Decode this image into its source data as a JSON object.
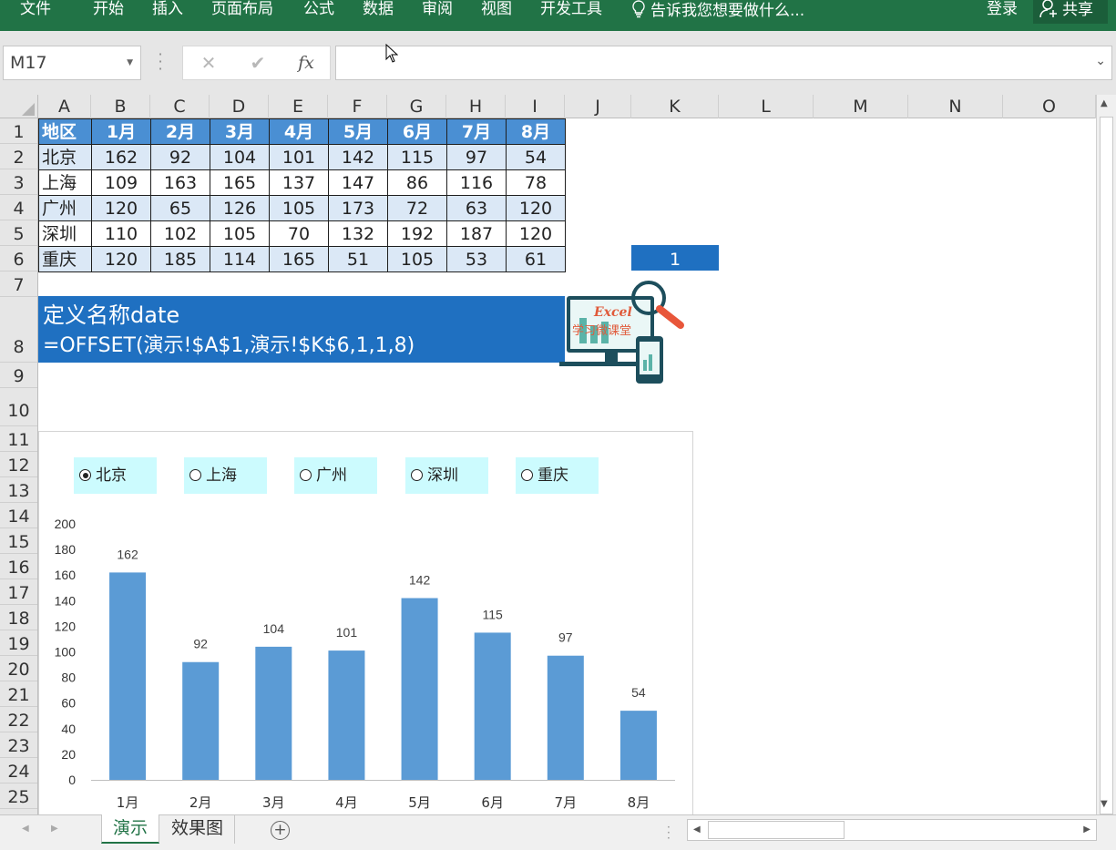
{
  "ribbon": {
    "tabs": [
      "文件",
      "开始",
      "插入",
      "页面布局",
      "公式",
      "数据",
      "审阅",
      "视图",
      "开发工具"
    ],
    "tell_me": "告诉我您想要做什么...",
    "login": "登录",
    "share": "共享"
  },
  "formula_bar": {
    "name_box": "M17",
    "cancel_icon": "✕",
    "enter_icon": "✔",
    "fx_label": "fx",
    "formula": ""
  },
  "columns": [
    "A",
    "B",
    "C",
    "D",
    "E",
    "F",
    "G",
    "H",
    "I",
    "J",
    "K",
    "L",
    "M",
    "N",
    "O"
  ],
  "rows": [
    "1",
    "2",
    "3",
    "4",
    "5",
    "6",
    "7",
    "8",
    "9",
    "10",
    "11",
    "12",
    "13",
    "14",
    "15",
    "16",
    "17",
    "18",
    "19",
    "20",
    "21",
    "22",
    "23",
    "24",
    "25"
  ],
  "table": {
    "header": [
      "地区",
      "1月",
      "2月",
      "3月",
      "4月",
      "5月",
      "6月",
      "7月",
      "8月"
    ],
    "rows": [
      [
        "北京",
        "162",
        "92",
        "104",
        "101",
        "142",
        "115",
        "97",
        "54"
      ],
      [
        "上海",
        "109",
        "163",
        "165",
        "137",
        "147",
        "86",
        "116",
        "78"
      ],
      [
        "广州",
        "120",
        "65",
        "126",
        "105",
        "173",
        "72",
        "63",
        "120"
      ],
      [
        "深圳",
        "110",
        "102",
        "105",
        "70",
        "132",
        "192",
        "187",
        "120"
      ],
      [
        "重庆",
        "120",
        "185",
        "114",
        "165",
        "51",
        "105",
        "53",
        "61"
      ]
    ]
  },
  "k6_value": "1",
  "banner": {
    "line1": "定义名称date",
    "line2": "=OFFSET(演示!$A$1,演示!$K$6,1,1,8)"
  },
  "logo": {
    "brand": "Excel",
    "subtitle": "学习微课堂"
  },
  "options": [
    {
      "label": "北京",
      "selected": true
    },
    {
      "label": "上海",
      "selected": false
    },
    {
      "label": "广州",
      "selected": false
    },
    {
      "label": "深圳",
      "selected": false
    },
    {
      "label": "重庆",
      "selected": false
    }
  ],
  "chart_data": {
    "type": "bar",
    "categories": [
      "1月",
      "2月",
      "3月",
      "4月",
      "5月",
      "6月",
      "7月",
      "8月"
    ],
    "values": [
      162,
      92,
      104,
      101,
      142,
      115,
      97,
      54
    ],
    "ylim": [
      0,
      200
    ],
    "yticks": [
      0,
      20,
      40,
      60,
      80,
      100,
      120,
      140,
      160,
      180,
      200
    ],
    "data_labels": true,
    "bar_color": "#5b9bd5",
    "grid": false,
    "legend": "none"
  },
  "sheets": [
    {
      "name": "演示",
      "active": true
    },
    {
      "name": "效果图",
      "active": false
    }
  ],
  "add_sheet": "+",
  "colors": {
    "ribbon": "#217346",
    "header_fill": "#4a8fd3",
    "band_fill": "#dbe8f6",
    "highlight": "#1f70c1",
    "option_fill": "#ccfbfe"
  }
}
